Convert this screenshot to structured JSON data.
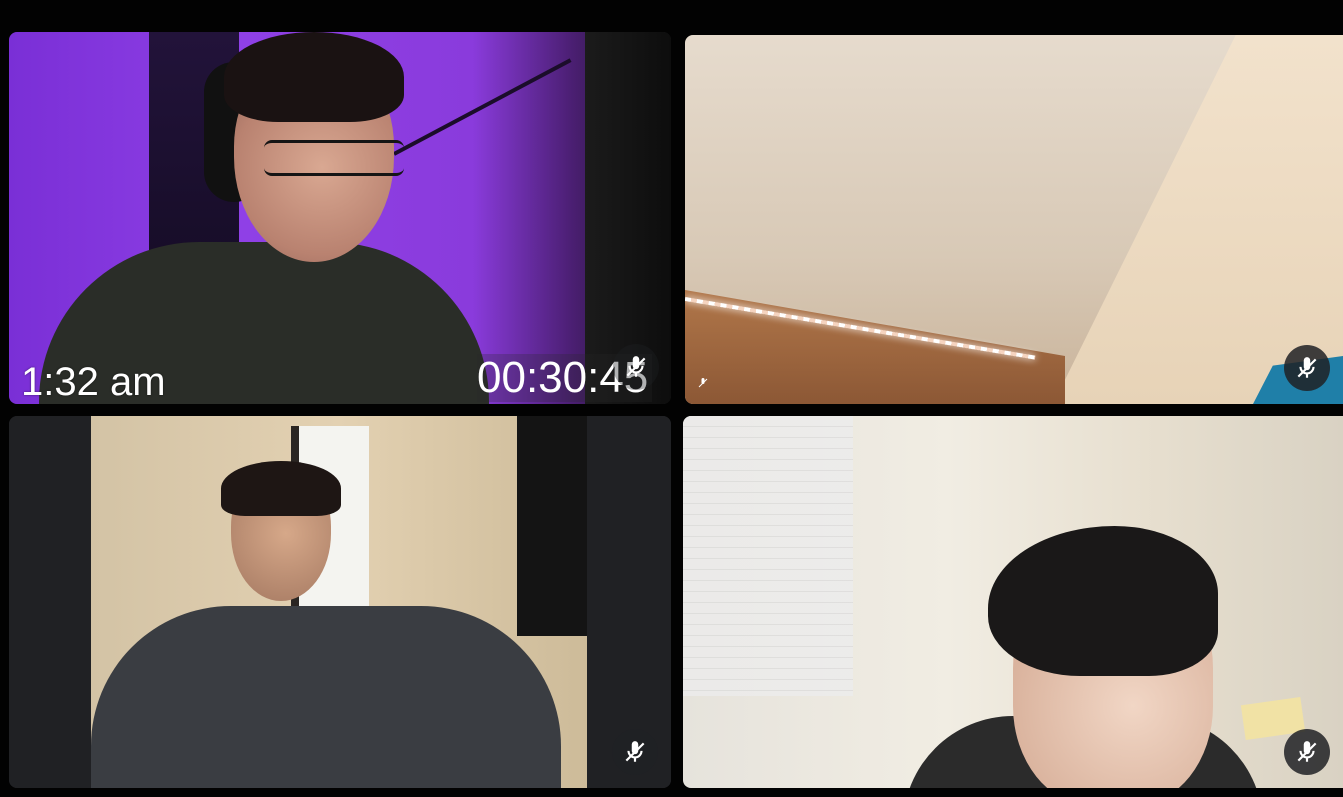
{
  "meeting": {
    "participants": [
      {
        "tile": 1,
        "overlay_left": "1:32 am",
        "overlay_right": "00:30:45",
        "mic_icon": "mic-off-icon"
      },
      {
        "tile": 2,
        "mic_icon": "mic-off-icon",
        "small_indicator": "mic-off-small-icon"
      },
      {
        "tile": 3,
        "mic_icon": "mic-off-icon"
      },
      {
        "tile": 4,
        "mic_icon": "mic-off-icon"
      }
    ],
    "colors": {
      "background": "#000000",
      "tile_bg": "#202124",
      "icon": "#ffffff"
    }
  }
}
